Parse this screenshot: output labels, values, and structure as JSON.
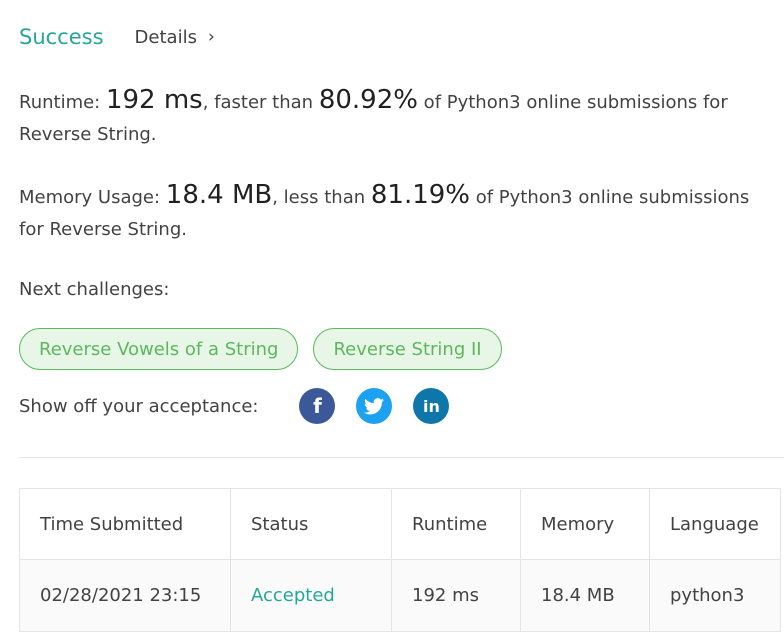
{
  "header": {
    "status": "Success",
    "details_label": "Details"
  },
  "runtime": {
    "label": "Runtime: ",
    "value": "192 ms",
    "comparison": ", faster than ",
    "percent": "80.92%",
    "suffix": " of Python3 online submissions for Reverse String."
  },
  "memory": {
    "label": "Memory Usage: ",
    "value": "18.4 MB",
    "comparison": ", less than ",
    "percent": "81.19%",
    "suffix": " of Python3 online submissions for Reverse String."
  },
  "next": {
    "label": "Next challenges:",
    "challenges": [
      "Reverse Vowels of a String",
      "Reverse String II"
    ]
  },
  "share": {
    "label": "Show off your acceptance:",
    "icons": [
      "facebook-icon",
      "twitter-icon",
      "linkedin-icon"
    ]
  },
  "table": {
    "headers": [
      "Time Submitted",
      "Status",
      "Runtime",
      "Memory",
      "Language"
    ],
    "rows": [
      [
        "02/28/2021 23:15",
        "Accepted",
        "192 ms",
        "18.4 MB",
        "python3"
      ]
    ]
  },
  "colors": {
    "success": "#26a69a",
    "pill_green": "#5cb85c",
    "facebook": "#3b5998",
    "twitter": "#1da1f2",
    "linkedin": "#0e76a8"
  }
}
